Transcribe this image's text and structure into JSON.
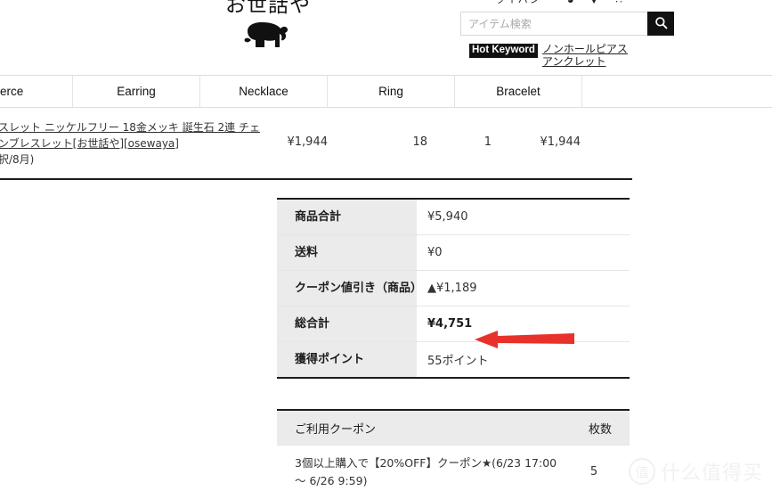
{
  "header": {
    "top_icons": [
      {
        "name": "utility-text",
        "glyph": "ライバシー"
      },
      {
        "name": "clock-icon",
        "glyph": "◕"
      },
      {
        "name": "caret-down-icon",
        "glyph": "▼"
      },
      {
        "name": "more-options-icon",
        "glyph": "⁙"
      }
    ],
    "logo_text": "お世話や",
    "logo_mark": "elephant-logo",
    "search": {
      "placeholder": "アイテム検索",
      "value": "",
      "button_icon": "search-icon"
    },
    "hot_keyword": {
      "badge": "Hot Keyword",
      "links": [
        "ノンホールピアス",
        "アンクレット"
      ]
    }
  },
  "nav": {
    "items": [
      {
        "label": "erce",
        "clipped": true
      },
      {
        "label": "Earring",
        "clipped": false
      },
      {
        "label": "Necklace",
        "clipped": false
      },
      {
        "label": "Ring",
        "clipped": false
      },
      {
        "label": "Bracelet",
        "clipped": false
      }
    ]
  },
  "cart": {
    "line_item": {
      "name_line1": "スレット ニッケルフリー 18金メッキ 誕生石 2連 チェ",
      "name_line2": "ンブレスレット[お世話や][osewaya]",
      "name_line3": "択/8月)",
      "price": "¥1,944",
      "points": "18",
      "quantity": "1",
      "subtotal": "¥1,944"
    }
  },
  "summary": {
    "rows": [
      {
        "label": "商品合計",
        "value": "¥5,940",
        "bold": false,
        "two_line": false
      },
      {
        "label": "送料",
        "value": "¥0",
        "bold": false,
        "two_line": false
      },
      {
        "label": "クーポン値引き（商品）",
        "value": "▲¥1,189",
        "bold": false,
        "two_line": true
      },
      {
        "label": "総合計",
        "value": "¥4,751",
        "bold": true,
        "two_line": false
      },
      {
        "label": "獲得ポイント",
        "value": "55ポイント",
        "bold": false,
        "two_line": false
      }
    ]
  },
  "annotation": {
    "arrow_color": "#e8312a",
    "arrow_target": "総合計"
  },
  "coupons": {
    "header": {
      "name": "ご利用クーポン",
      "qty": "枚数"
    },
    "rows": [
      {
        "name": "3個以上購入で【20%OFF】クーポン★(6/23 17:00 ～ 6/26 9:59)",
        "qty": "5"
      }
    ]
  },
  "watermark": {
    "mark": "值",
    "text": "什么值得买"
  }
}
